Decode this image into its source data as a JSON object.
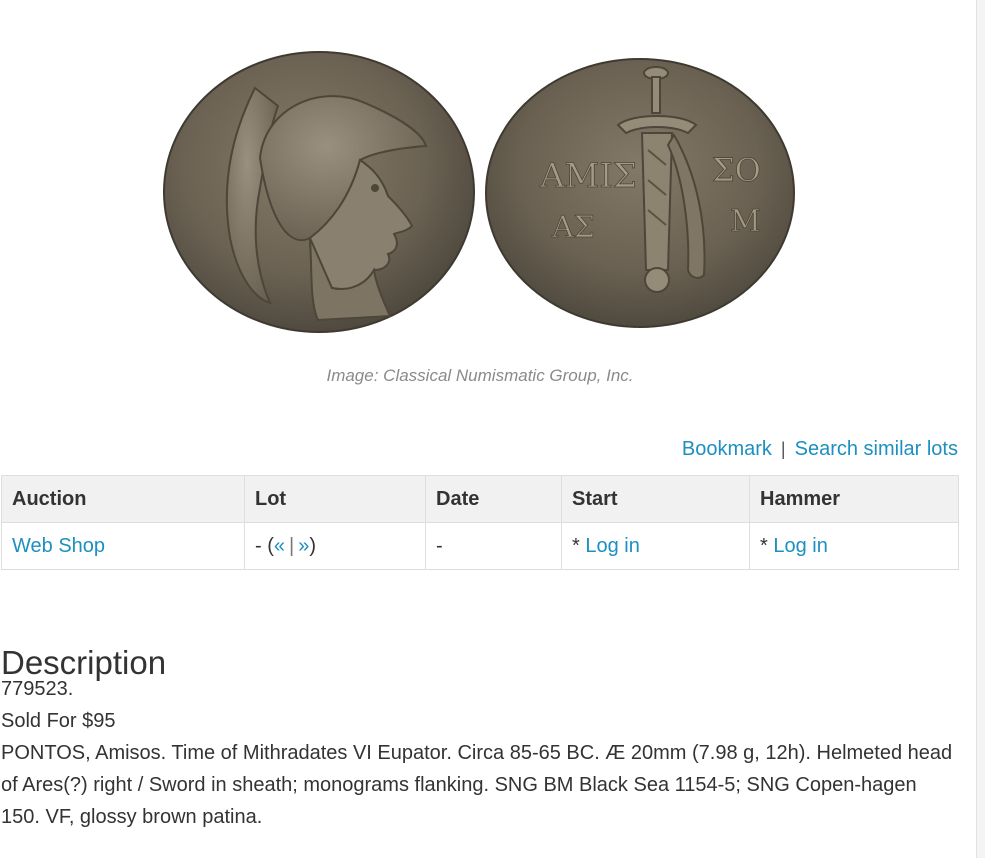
{
  "image_caption": "Image: Classical Numismatic Group, Inc.",
  "actions": {
    "bookmark": "Bookmark",
    "separator": "|",
    "search_similar": "Search similar lots"
  },
  "table": {
    "headers": [
      "Auction",
      "Lot",
      "Date",
      "Start",
      "Hammer"
    ],
    "row": {
      "auction": "Web Shop",
      "lot_prefix": "- (",
      "lot_prev": "«",
      "lot_sep": "|",
      "lot_next": "»",
      "lot_suffix": ")",
      "date": "-",
      "start_prefix": "* ",
      "start_link": "Log in",
      "hammer_prefix": "* ",
      "hammer_link": "Log in"
    }
  },
  "description": {
    "title": "Description",
    "id_line": "779523.",
    "sold_line": "Sold For $95",
    "text": "PONTOS, Amisos. Time of Mithradates VI Eupator. Circa 85-65 BC. Æ 20mm (7.98 g, 12h). Helmeted head of Ares(?) right / Sword in sheath; monograms flanking. SNG BM Black Sea 1154-5; SNG Copen-hagen 150. VF, glossy brown patina."
  },
  "coin_inscriptions": {
    "left_top": "ΑΜΙΣ",
    "left_bottom": "ΑΣ",
    "right_top": "ΣΟ",
    "right_bottom": "Μ"
  },
  "colors": {
    "link": "#1d8fc0",
    "header_bg": "#f1f1f1",
    "border": "#dedede",
    "coin_bronze": "#6b6253"
  }
}
